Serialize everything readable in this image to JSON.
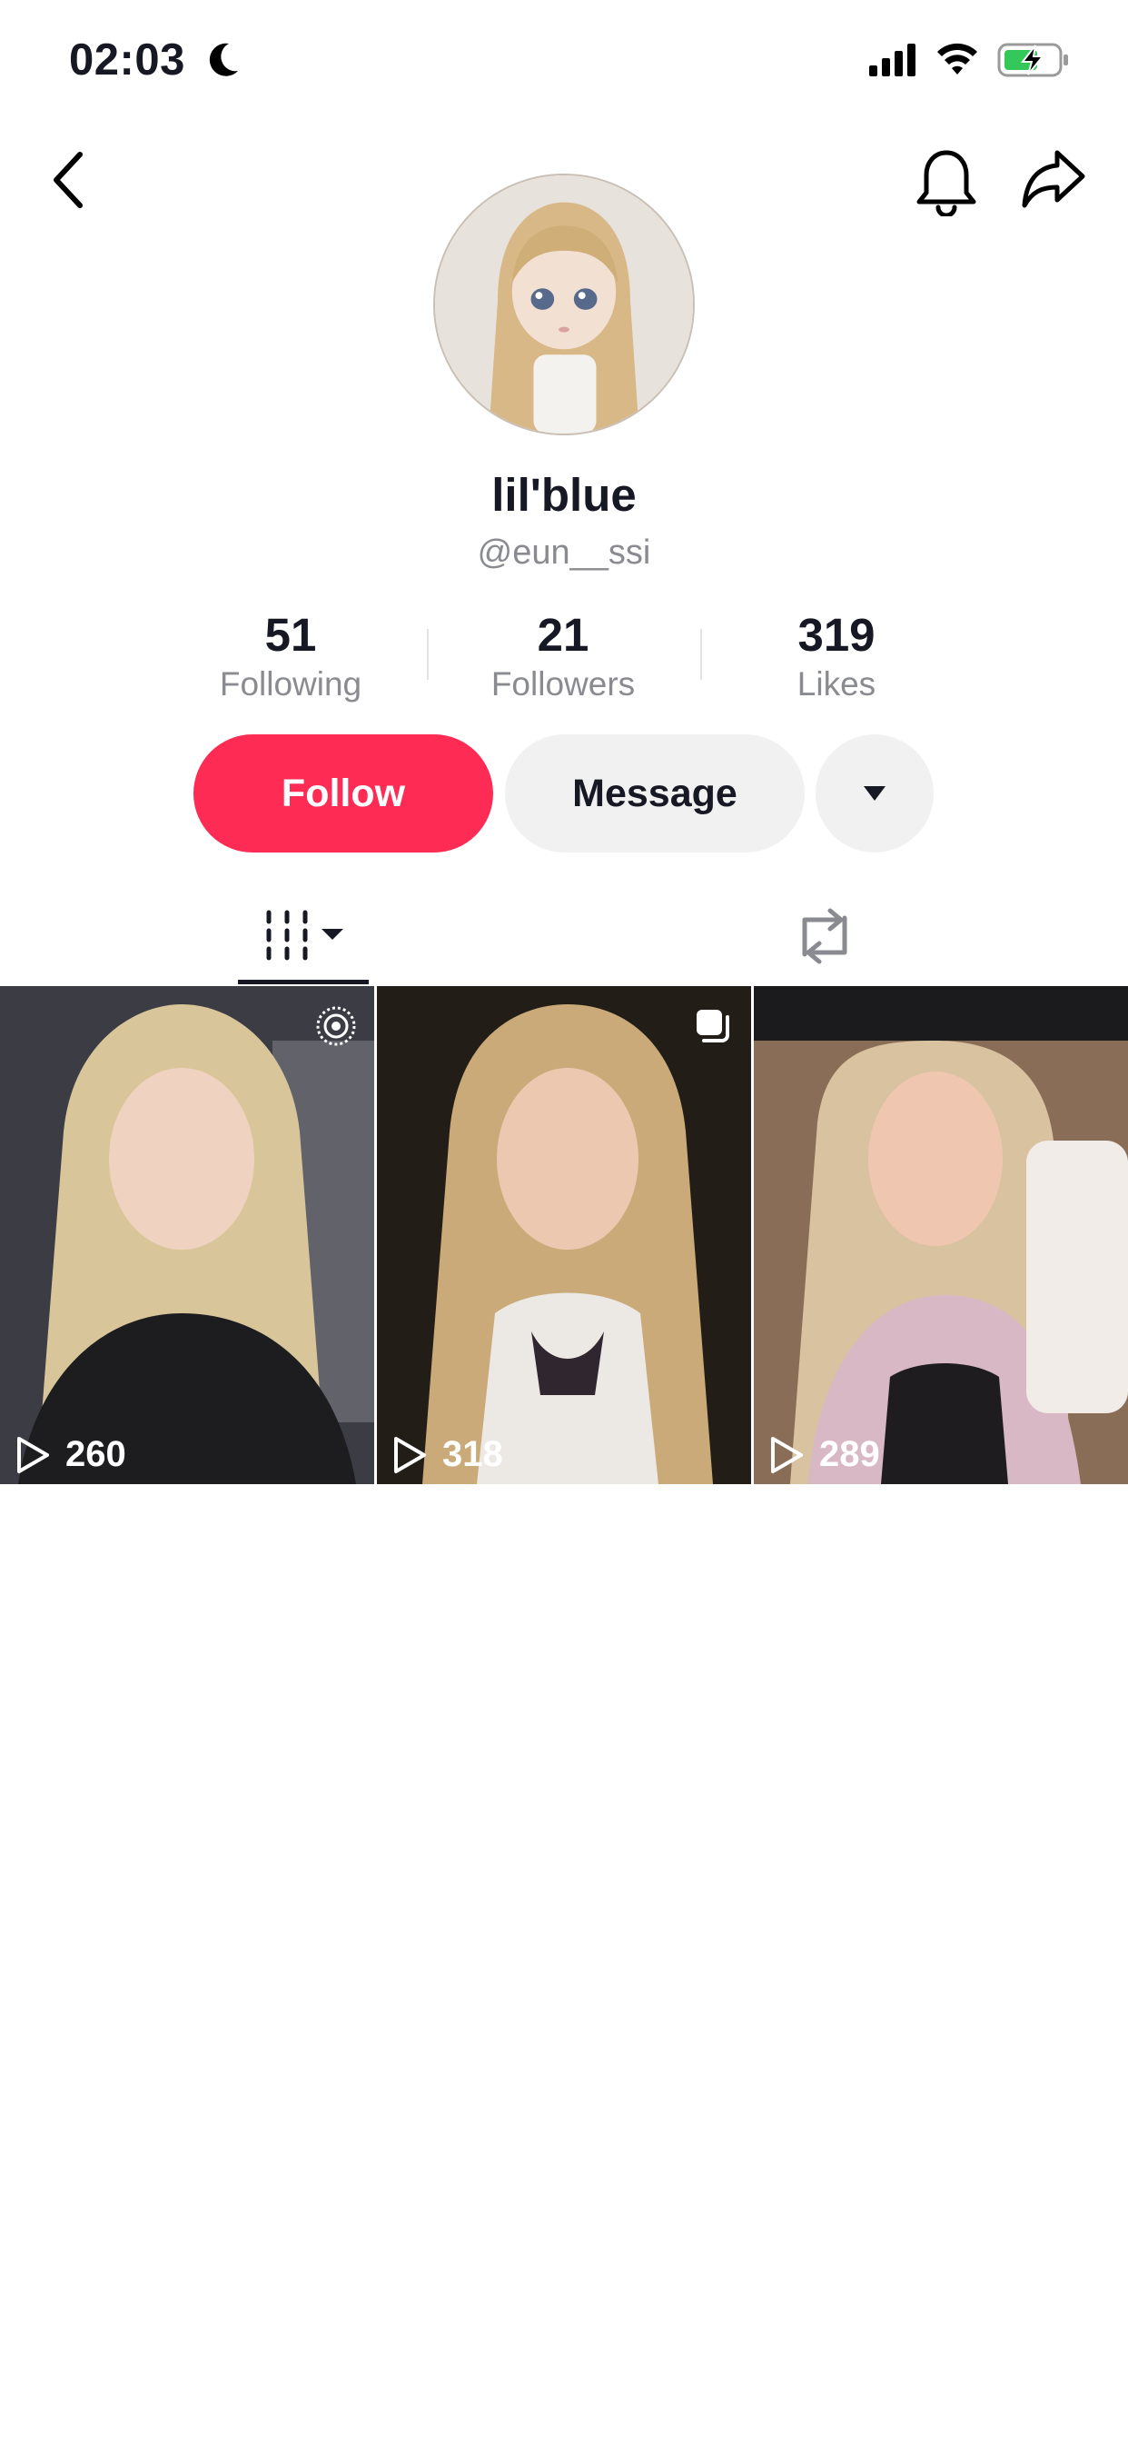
{
  "status_bar": {
    "time": "02:03"
  },
  "profile": {
    "display_name": "lil'blue",
    "username": "@eun__ssi"
  },
  "stats": [
    {
      "value": "51",
      "label": "Following"
    },
    {
      "value": "21",
      "label": "Followers"
    },
    {
      "value": "319",
      "label": "Likes"
    }
  ],
  "actions": {
    "follow_label": "Follow",
    "message_label": "Message"
  },
  "tabs": [
    {
      "icon": "videos-grid-icon",
      "selected": true
    },
    {
      "icon": "repost-icon",
      "selected": false
    }
  ],
  "videos": [
    {
      "views": "260",
      "badge": "live-photo-icon"
    },
    {
      "views": "318",
      "badge": "copy-icon"
    },
    {
      "views": "289",
      "badge": ""
    }
  ],
  "colors": {
    "accent": "#fe2c55",
    "text": "#161823",
    "secondary": "#8a8b91",
    "button_gray": "#f1f1f2"
  }
}
